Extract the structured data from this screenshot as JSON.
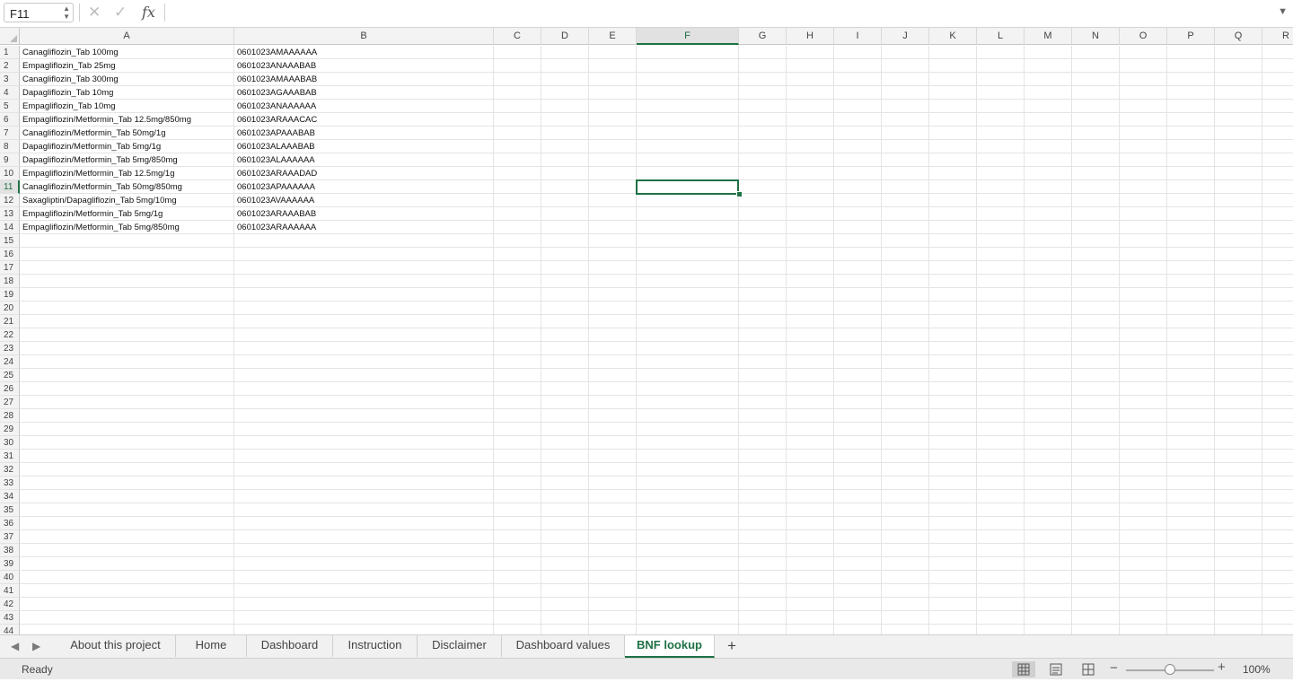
{
  "formula_bar": {
    "name_box": "F11",
    "fx_label": "fx",
    "cancel_icon": "close-icon",
    "confirm_icon": "check-icon",
    "formula_value": ""
  },
  "columns": [
    "A",
    "B",
    "C",
    "D",
    "E",
    "F",
    "G",
    "H",
    "I",
    "J",
    "K",
    "L",
    "M",
    "N",
    "O",
    "P",
    "Q",
    "R"
  ],
  "selected_column": "F",
  "selected_row": 11,
  "rows": [
    "1",
    "2",
    "3",
    "4",
    "5",
    "6",
    "7",
    "8",
    "9",
    "10",
    "11",
    "12",
    "13",
    "14",
    "15",
    "16",
    "17",
    "18",
    "19",
    "20",
    "21",
    "22",
    "23",
    "24",
    "25",
    "26",
    "27",
    "28",
    "29",
    "30",
    "31",
    "32",
    "33",
    "34",
    "35",
    "36",
    "37",
    "38",
    "39",
    "40",
    "41",
    "42",
    "43",
    "44"
  ],
  "data": [
    {
      "a": "Canagliflozin_Tab 100mg",
      "b": "0601023AMAAAAAA"
    },
    {
      "a": "Empagliflozin_Tab 25mg",
      "b": "0601023ANAAABAB"
    },
    {
      "a": "Canagliflozin_Tab 300mg",
      "b": "0601023AMAAABAB"
    },
    {
      "a": "Dapagliflozin_Tab 10mg",
      "b": "0601023AGAAABAB"
    },
    {
      "a": "Empagliflozin_Tab 10mg",
      "b": "0601023ANAAAAAA"
    },
    {
      "a": "Empagliflozin/Metformin_Tab 12.5mg/850mg",
      "b": "0601023ARAAACAC"
    },
    {
      "a": "Canagliflozin/Metformin_Tab 50mg/1g",
      "b": "0601023APAAABAB"
    },
    {
      "a": "Dapagliflozin/Metformin_Tab 5mg/1g",
      "b": "0601023ALAAABAB"
    },
    {
      "a": "Dapagliflozin/Metformin_Tab 5mg/850mg",
      "b": "0601023ALAAAAAA"
    },
    {
      "a": "Empagliflozin/Metformin_Tab 12.5mg/1g",
      "b": "0601023ARAAADAD"
    },
    {
      "a": "Canagliflozin/Metformin_Tab 50mg/850mg",
      "b": "0601023APAAAAAA"
    },
    {
      "a": "Saxagliptin/Dapagliflozin_Tab 5mg/10mg",
      "b": "0601023AVAAAAAA"
    },
    {
      "a": "Empagliflozin/Metformin_Tab 5mg/1g",
      "b": "0601023ARAAABAB"
    },
    {
      "a": "Empagliflozin/Metformin_Tab 5mg/850mg",
      "b": "0601023ARAAAAAA"
    }
  ],
  "sheet_tabs": [
    "About this project",
    "Home",
    "Dashboard",
    "Instruction",
    "Disclaimer",
    "Dashboard values",
    "BNF lookup"
  ],
  "active_tab": "BNF lookup",
  "add_sheet_label": "+",
  "status": {
    "ready": "Ready",
    "zoom": "100%",
    "zoom_level": 1.0
  },
  "colors": {
    "accent": "#1e7145"
  }
}
